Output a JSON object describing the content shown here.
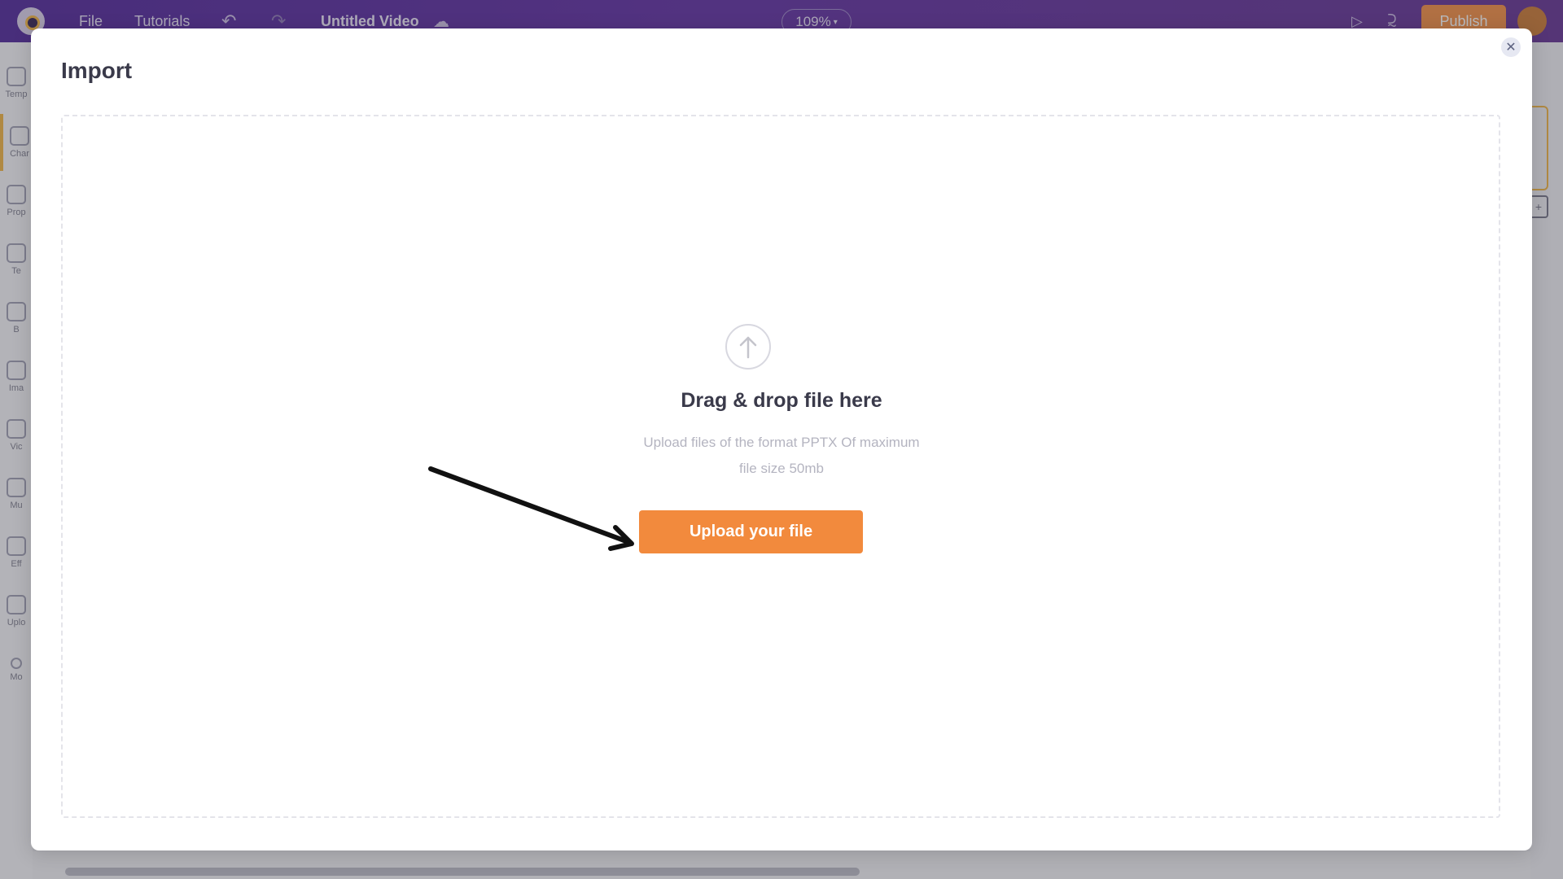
{
  "topbar": {
    "file_label": "File",
    "tutorials_label": "Tutorials",
    "undo_icon": "undo-icon",
    "redo_icon": "redo-icon",
    "title": "Untitled Video",
    "cloud_icon": "cloud-check-icon",
    "zoom": "109%",
    "play_icon": "play-icon",
    "share_icon": "share-icon",
    "publish_label": "Publish",
    "colors": {
      "bar": "#4a1f96",
      "publish": "#f28a3d"
    }
  },
  "sidebar": {
    "items": [
      {
        "label": "Temp",
        "icon": "templates-icon"
      },
      {
        "label": "Char",
        "icon": "characters-icon",
        "active": true
      },
      {
        "label": "Prop",
        "icon": "props-icon"
      },
      {
        "label": "Te",
        "icon": "text-icon"
      },
      {
        "label": "B",
        "icon": "backgrounds-icon"
      },
      {
        "label": "Ima",
        "icon": "images-icon"
      },
      {
        "label": "Vic",
        "icon": "video-icon"
      },
      {
        "label": "Mu",
        "icon": "music-icon"
      },
      {
        "label": "Eff",
        "icon": "effects-icon"
      },
      {
        "label": "Uplo",
        "icon": "upload-icon"
      },
      {
        "label": "Mo",
        "icon": "more-icon"
      }
    ],
    "accent": "#f0b23a"
  },
  "modal": {
    "title": "Import",
    "close_icon": "close-icon",
    "upload_icon": "arrow-up-icon",
    "heading": "Drag & drop file here",
    "hint_line1": "Upload files of the format PPTX Of maximum",
    "hint_line2": "file size 50mb",
    "button_label": "Upload your file",
    "button_color": "#f28a3d"
  }
}
